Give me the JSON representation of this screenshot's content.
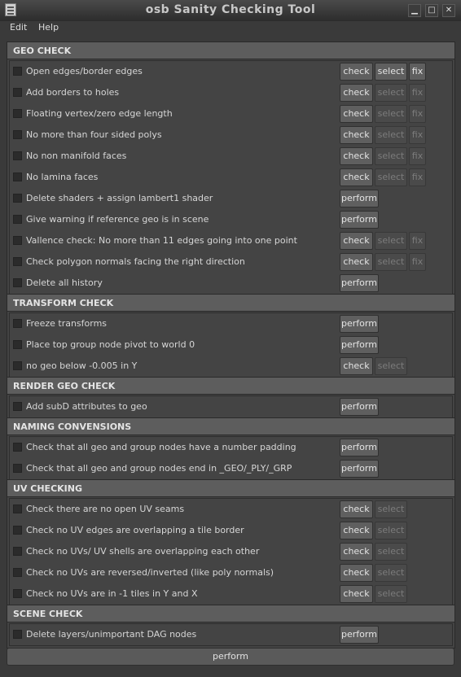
{
  "window": {
    "title": "osb Sanity Checking Tool",
    "minimize": "▁",
    "maximize": "□",
    "close": "✕"
  },
  "menu": [
    "Edit",
    "Help"
  ],
  "sections": [
    {
      "title": "GEO CHECK",
      "rows": [
        {
          "label": "Open edges/border edges",
          "buttons": [
            {
              "label": "check",
              "enabled": true
            },
            {
              "label": "select",
              "enabled": true
            },
            {
              "label": "fix",
              "enabled": true
            }
          ]
        },
        {
          "label": "Add borders to holes",
          "buttons": [
            {
              "label": "check",
              "enabled": true
            },
            {
              "label": "select",
              "enabled": false
            },
            {
              "label": "fix",
              "enabled": false
            }
          ]
        },
        {
          "label": "Floating vertex/zero edge length",
          "buttons": [
            {
              "label": "check",
              "enabled": true
            },
            {
              "label": "select",
              "enabled": false
            },
            {
              "label": "fix",
              "enabled": false
            }
          ]
        },
        {
          "label": "No more than four sided polys",
          "buttons": [
            {
              "label": "check",
              "enabled": true
            },
            {
              "label": "select",
              "enabled": false
            },
            {
              "label": "fix",
              "enabled": false
            }
          ]
        },
        {
          "label": "No non manifold faces",
          "buttons": [
            {
              "label": "check",
              "enabled": true
            },
            {
              "label": "select",
              "enabled": false
            },
            {
              "label": "fix",
              "enabled": false
            }
          ]
        },
        {
          "label": "No lamina faces",
          "buttons": [
            {
              "label": "check",
              "enabled": true
            },
            {
              "label": "select",
              "enabled": false
            },
            {
              "label": "fix",
              "enabled": false
            }
          ]
        },
        {
          "label": "Delete shaders + assign lambert1 shader",
          "buttons": [
            {
              "label": "perform",
              "enabled": true
            }
          ]
        },
        {
          "label": "Give warning if reference geo is in scene",
          "buttons": [
            {
              "label": "perform",
              "enabled": true
            }
          ]
        },
        {
          "label": "Vallence check: No more than 11 edges going into one point",
          "buttons": [
            {
              "label": "check",
              "enabled": true
            },
            {
              "label": "select",
              "enabled": false
            },
            {
              "label": "fix",
              "enabled": false
            }
          ]
        },
        {
          "label": "Check polygon normals facing the right direction",
          "buttons": [
            {
              "label": "check",
              "enabled": true
            },
            {
              "label": "select",
              "enabled": false
            },
            {
              "label": "fix",
              "enabled": false
            }
          ]
        },
        {
          "label": "Delete all history",
          "buttons": [
            {
              "label": "perform",
              "enabled": true
            }
          ]
        }
      ]
    },
    {
      "title": "TRANSFORM CHECK",
      "rows": [
        {
          "label": "Freeze transforms",
          "buttons": [
            {
              "label": "perform",
              "enabled": true
            }
          ]
        },
        {
          "label": "Place top group node pivot to world 0",
          "buttons": [
            {
              "label": "perform",
              "enabled": true
            }
          ]
        },
        {
          "label": "no geo below -0.005 in Y",
          "buttons": [
            {
              "label": "check",
              "enabled": true
            },
            {
              "label": "select",
              "enabled": false
            }
          ]
        }
      ]
    },
    {
      "title": "RENDER GEO CHECK",
      "rows": [
        {
          "label": "Add subD attributes to geo",
          "buttons": [
            {
              "label": "perform",
              "enabled": true
            }
          ]
        }
      ]
    },
    {
      "title": "NAMING CONVENSIONS",
      "rows": [
        {
          "label": "Check that all geo and group nodes have a number padding",
          "buttons": [
            {
              "label": "perform",
              "enabled": true
            }
          ]
        },
        {
          "label": "Check that all geo and group nodes end in _GEO/_PLY/_GRP",
          "buttons": [
            {
              "label": "perform",
              "enabled": true
            }
          ]
        }
      ]
    },
    {
      "title": "UV CHECKING",
      "rows": [
        {
          "label": "Check there are no open UV seams",
          "buttons": [
            {
              "label": "check",
              "enabled": true
            },
            {
              "label": "select",
              "enabled": false
            }
          ]
        },
        {
          "label": "Check no UV edges are overlapping a tile border",
          "buttons": [
            {
              "label": "check",
              "enabled": true
            },
            {
              "label": "select",
              "enabled": false
            }
          ]
        },
        {
          "label": "Check no UVs/ UV shells are overlapping each other",
          "buttons": [
            {
              "label": "check",
              "enabled": true
            },
            {
              "label": "select",
              "enabled": false
            }
          ]
        },
        {
          "label": "Check no UVs are reversed/inverted (like poly normals)",
          "buttons": [
            {
              "label": "check",
              "enabled": true
            },
            {
              "label": "select",
              "enabled": false
            }
          ]
        },
        {
          "label": "Check no UVs are in -1 tiles in Y and X",
          "buttons": [
            {
              "label": "check",
              "enabled": true
            },
            {
              "label": "select",
              "enabled": false
            }
          ]
        }
      ]
    },
    {
      "title": "SCENE CHECK",
      "rows": [
        {
          "label": "Delete layers/unimportant DAG nodes",
          "buttons": [
            {
              "label": "perform",
              "enabled": true
            }
          ]
        }
      ]
    }
  ],
  "footer": {
    "perform_label": "perform"
  }
}
